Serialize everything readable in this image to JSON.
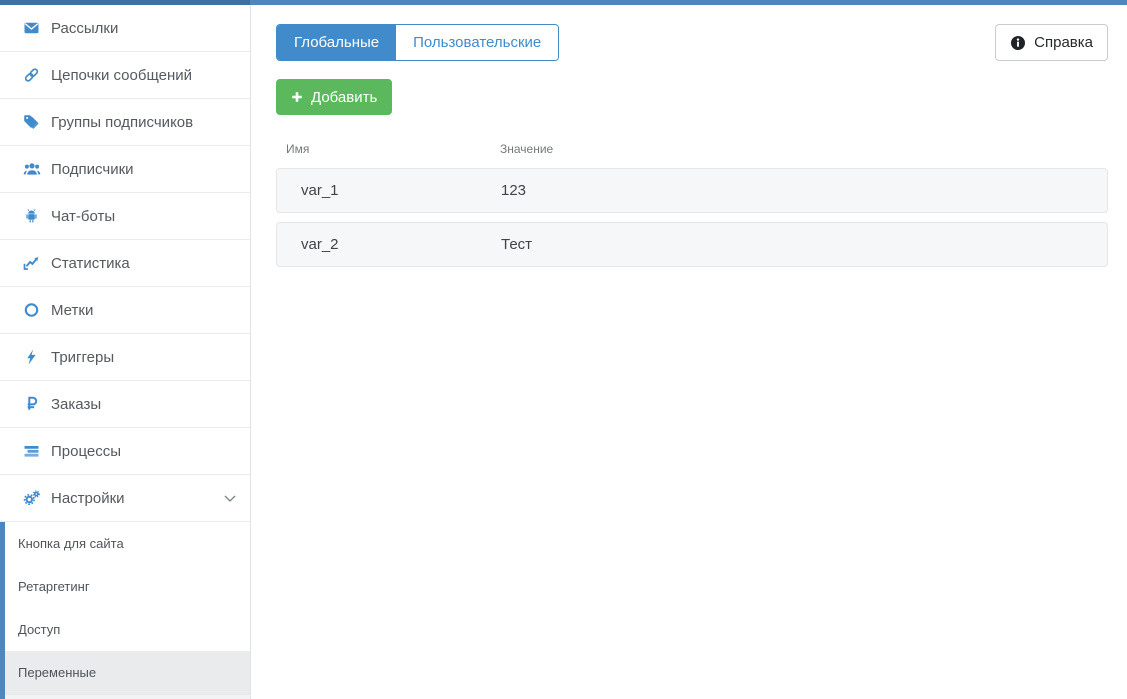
{
  "sidebar": {
    "items": [
      {
        "label": "Рассылки",
        "icon": "envelope-icon"
      },
      {
        "label": "Цепочки сообщений",
        "icon": "link-icon"
      },
      {
        "label": "Группы подписчиков",
        "icon": "tags-icon"
      },
      {
        "label": "Подписчики",
        "icon": "users-icon"
      },
      {
        "label": "Чат-боты",
        "icon": "robot-icon"
      },
      {
        "label": "Статистика",
        "icon": "line-chart-icon"
      },
      {
        "label": "Метки",
        "icon": "circle-icon"
      },
      {
        "label": "Триггеры",
        "icon": "bolt-icon"
      },
      {
        "label": "Заказы",
        "icon": "ruble-icon"
      },
      {
        "label": "Процессы",
        "icon": "tasks-icon"
      },
      {
        "label": "Настройки",
        "icon": "gears-icon",
        "expanded": true
      }
    ],
    "submenu": [
      {
        "label": "Кнопка для сайта",
        "selected": false
      },
      {
        "label": "Ретаргетинг",
        "selected": false
      },
      {
        "label": "Доступ",
        "selected": false
      },
      {
        "label": "Переменные",
        "selected": true
      }
    ]
  },
  "main": {
    "tabs": [
      {
        "label": "Глобальные",
        "active": true
      },
      {
        "label": "Пользовательские",
        "active": false
      }
    ],
    "add_button_label": "Добавить",
    "help_button_label": "Справка",
    "table": {
      "columns": [
        "Имя",
        "Значение"
      ],
      "rows": [
        {
          "name": "var_1",
          "value": "123"
        },
        {
          "name": "var_2",
          "value": "Тест"
        }
      ]
    }
  },
  "colors": {
    "accent_blue": "#428bca",
    "topbar_left": "#3d71a3",
    "topbar_right": "#4d87bd",
    "add_button_green": "#5cb85c",
    "row_background": "#f6f7f8",
    "selected_submenu_background": "#e9ebed"
  }
}
